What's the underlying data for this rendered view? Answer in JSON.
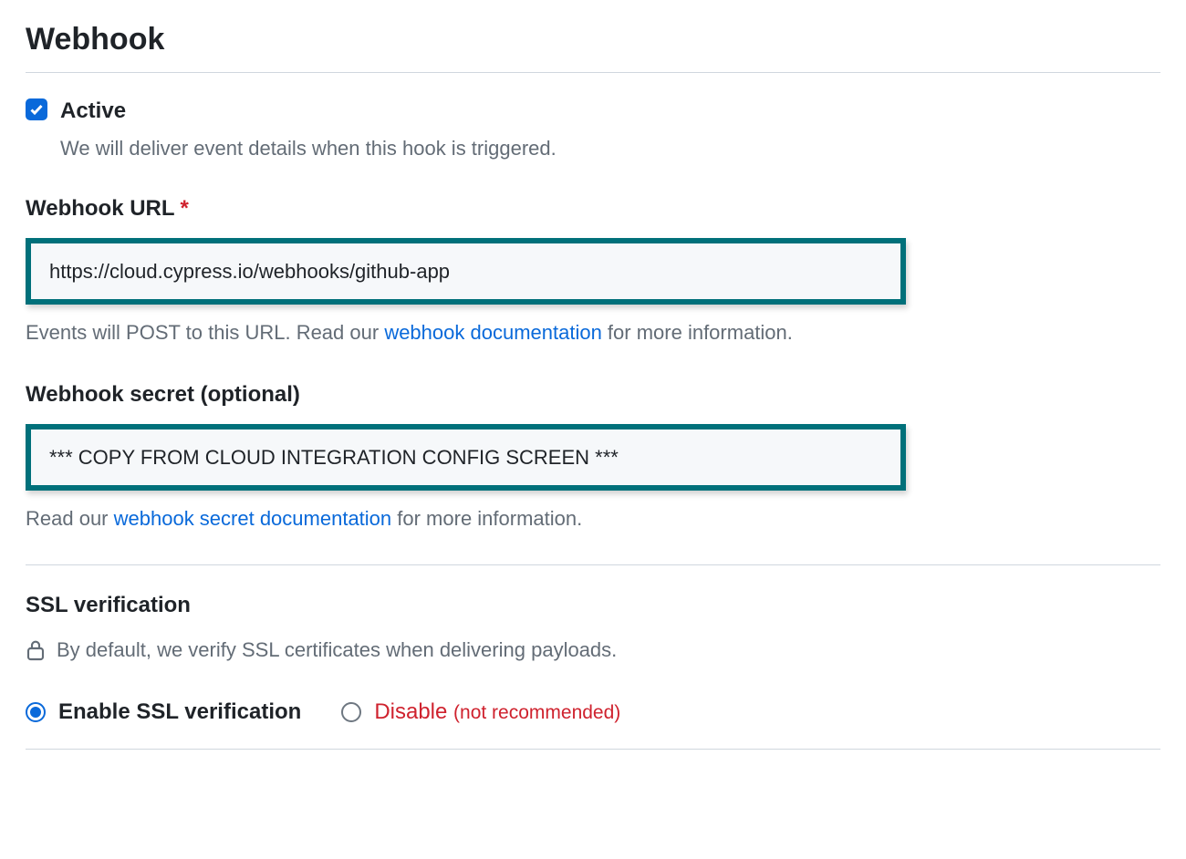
{
  "header": {
    "title": "Webhook"
  },
  "active": {
    "label": "Active",
    "description": "We will deliver event details when this hook is triggered.",
    "checked": true
  },
  "url": {
    "label": "Webhook URL",
    "required_marker": "*",
    "value": "https://cloud.cypress.io/webhooks/github-app",
    "help_prefix": "Events will POST to this URL. Read our ",
    "help_link": "webhook documentation",
    "help_suffix": " for more information."
  },
  "secret": {
    "label": "Webhook secret (optional)",
    "value": "*** COPY FROM CLOUD INTEGRATION CONFIG SCREEN ***",
    "help_prefix": "Read our ",
    "help_link": "webhook secret documentation",
    "help_suffix": " for more information."
  },
  "ssl": {
    "heading": "SSL verification",
    "description": "By default, we verify SSL certificates when delivering payloads.",
    "options": {
      "enable_label": "Enable SSL verification",
      "disable_label": "Disable",
      "disable_note": "(not recommended)",
      "selected": "enable"
    }
  }
}
